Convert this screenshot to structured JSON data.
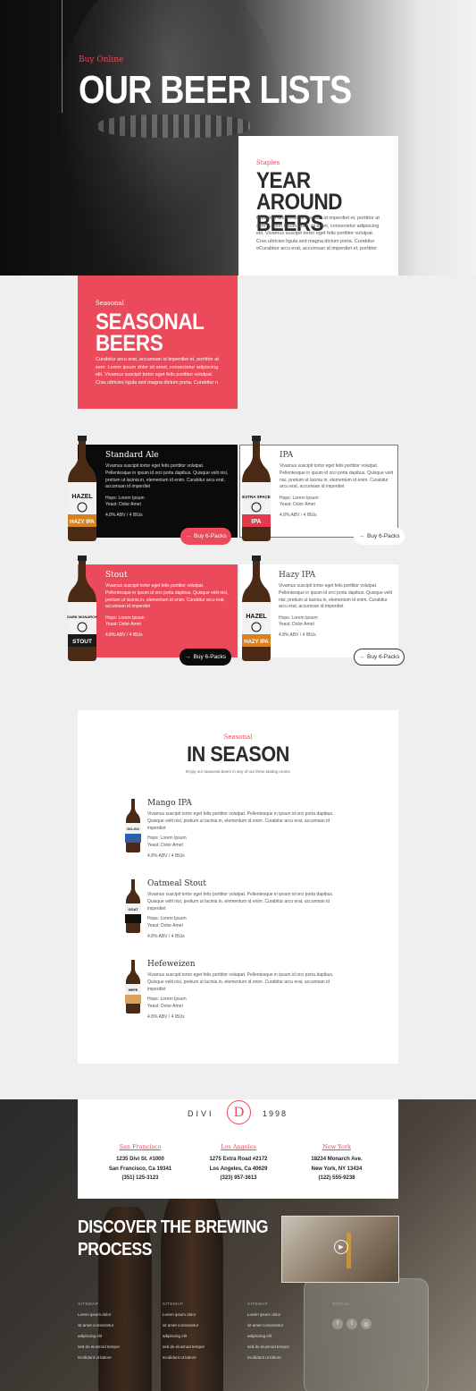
{
  "hero": {
    "eyebrow": "Buy Online",
    "title": "OUR BEER LISTS",
    "staples": {
      "eyebrow": "Staples",
      "title_line1": "YEAR AROUND",
      "title_line2": "BEERS",
      "text": "Curabitur arcu erat, accumsan id imperdiet et, porttitor at sem. Lorem ipsum dolor sit amet, consectetur adipiscing elit. Vivamus suscipit tortor eget felis porttitor volutpat. Cras ultricies ligula sed magna dictum porta. Curabitur ¤Curabitur arcu erat, accumsan id imperdiet et, porttitor"
    }
  },
  "seasonal": {
    "eyebrow": "Seasonal",
    "title_line1": "SEASONAL",
    "title_line2": "BEERS",
    "text": "Curabitur arcu erat, accumsan id imperdiet et, porttitor at sem. Lorem ipsum dolor sit amet, consectetur adipiscing elit. Vivamus suscipit tortor eget felis porttitor volutpat. Cras ultricies ligula sed magna dictum porta. Curabitur n"
  },
  "beers": [
    {
      "name": "Standard Ale",
      "label_top": "HAZEL",
      "label_bottom": "HAZY IPA",
      "desc": "Vivamus suscipit tortor eget felis porttitor volutpat. Pellentesque in ipsum id orci porta dapibus. Quisque velit nisi, pretium ut lacinia in, elementum id enim. Curabitur arcu erat, accumsan id imperdiet",
      "hops": "Hops: Lorem Ipsum",
      "yeast": "Yeast: Dolor Amet",
      "abv": "4.8% ABV / 4 IBUs",
      "button": "Buy 6-Packs"
    },
    {
      "name": "IPA",
      "label_top": "EXTRA SPACE",
      "label_bottom": "IPA",
      "desc": "Vivamus suscipit tortor eget felis porttitor volutpat. Pellentesque in ipsum id orci porta dapibus. Quisque velit nisi, pretium ut lacinia in, elementum id enim. Curabitur arcu erat, accumsan id imperdiet",
      "hops": "Hops: Lorem Ipsum",
      "yeast": "Yeast: Dolor Amet",
      "abv": "4.8% ABV / 4 IBUs",
      "button": "Buy 6-Packs"
    },
    {
      "name": "Stout",
      "label_top": "DARK MONARCH",
      "label_bottom": "STOUT",
      "desc": "Vivamus suscipit tortor eget felis porttitor volutpat. Pellentesque in ipsum id orci porta dapibus. Quisque velit nisi, pretium ut lacinia in, elementum id enim. Curabitur arcu erat, accumsan id imperdiet",
      "hops": "Hops: Lorem Ipsum",
      "yeast": "Yeast: Dolor Amet",
      "abv": "4.8% ABV / 4 IBUs",
      "button": "Buy 6-Packs"
    },
    {
      "name": "Hazy IPA",
      "label_top": "HAZEL",
      "label_bottom": "HAZY IPA",
      "desc": "Vivamus suscipit tortor eget felis porttitor volutpat. Pellentesque in ipsum id orci porta dapibus. Quisque velit nisi, pretium ut lacinia in, elementum id enim. Curabitur arcu erat, accumsan id imperdiet",
      "hops": "Hops: Lorem Ipsum",
      "yeast": "Yeast: Dolor Amet",
      "abv": "4.8% ABV / 4 IBUs",
      "button": "Buy 6-Packs"
    }
  ],
  "in_season": {
    "eyebrow": "Seasonal",
    "title": "IN SEASON",
    "subtitle": "Enjoy our seasonal beers in any of our three tasting rooms",
    "items": [
      {
        "name": "Mango IPA",
        "label": "GO-GO",
        "desc": "Vivamus suscipit tortor eget felis porttitor volutpat. Pellentesque in ipsum id orci porta dapibus. Quisque velit nisi, pretium ut lacinia in, elementum id enim. Curabitur arcu erat, accumsan id imperdiet",
        "hops": "Hops: Lorem Ipsum",
        "yeast": "Yeast: Dolor Amet",
        "abv": "4.8% ABV / 4 IBUs"
      },
      {
        "name": "Oatmeal Stout",
        "label": "GOAT",
        "desc": "Vivamus suscipit tortor eget felis porttitor volutpat. Pellentesque in ipsum id orci porta dapibus. Quisque velit nisi, pretium ut lacinia in, elementum id enim. Curabitur arcu erat, accumsan id imperdiet",
        "hops": "Hops: Lorem Ipsum",
        "yeast": "Yeast: Dolor Amet",
        "abv": "4.8% ABV / 4 IBUs"
      },
      {
        "name": "Hefeweizen",
        "label": "HEFE",
        "desc": "Vivamus suscipit tortor eget felis porttitor volutpat. Pellentesque in ipsum id orci porta dapibus. Quisque velit nisi, pretium ut lacinia in, elementum id enim. Curabitur arcu erat, accumsan id imperdiet",
        "hops": "Hops: Lorem Ipsum",
        "yeast": "Yeast: Dolor Amet",
        "abv": "4.8% ABV / 4 IBUs"
      }
    ]
  },
  "brand": {
    "left": "DIVI",
    "letter": "D",
    "right": "1998"
  },
  "locations": [
    {
      "city": "San Francisco",
      "street": "1235 Divi St. #1000",
      "region": "San Francisco, Ca 19341",
      "phone": "(351) 125-3123"
    },
    {
      "city": "Los Angeles",
      "street": "1275 Extra Road #2172",
      "region": "Los Angeles, Ca 40629",
      "phone": "(323) 957-3613"
    },
    {
      "city": "New York",
      "street": "18234 Monarch Ave.",
      "region": "New York, NY 13434",
      "phone": "(122) 555-9238"
    }
  ],
  "discover": {
    "line1": "DISCOVER THE BREWING",
    "line2": "PROCESS"
  },
  "footer": {
    "columns": [
      {
        "title": "SITEMAP",
        "items": [
          "Lorem ipsum dolor",
          "sit amet consectetur",
          "adipiscing elit",
          "sed do eiusmod tempor",
          "incididunt ut labore"
        ]
      },
      {
        "title": "SITEMAP",
        "items": [
          "Lorem ipsum dolor",
          "sit amet consectetur",
          "adipiscing elit",
          "sed do eiusmod tempor",
          "incididunt ut labore"
        ]
      },
      {
        "title": "SITEMAP",
        "items": [
          "Lorem ipsum dolor",
          "sit amet consectetur",
          "adipiscing elit",
          "sed do eiusmod tempor",
          "incididunt ut labore"
        ]
      }
    ],
    "social_title": "SOCIAL",
    "social": [
      "f",
      "t",
      "◎"
    ]
  },
  "colors": {
    "accent": "#ea4a5a",
    "dark": "#0b0b0b",
    "text": "#333333"
  }
}
